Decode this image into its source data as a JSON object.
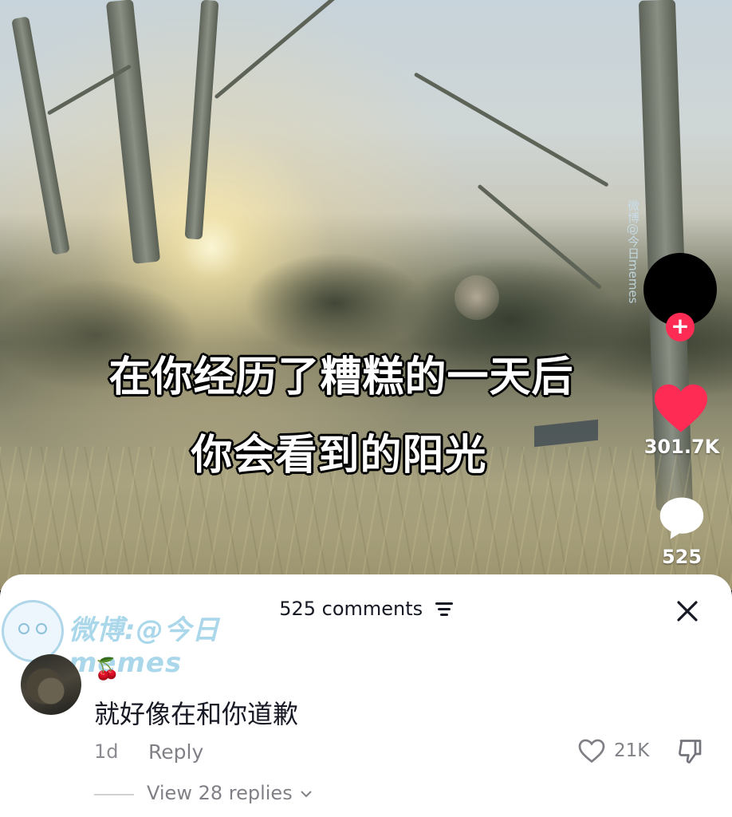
{
  "video": {
    "caption_line1": "在你经历了糟糕的一天后",
    "caption_line2": "你会看到的阳光",
    "watermark_vertical": "微博@今日memes"
  },
  "actions": {
    "follow_symbol": "+",
    "like_count": "301.7K",
    "comment_count": "525"
  },
  "comments": {
    "header": "525 comments",
    "watermark": "微博:@今日memes",
    "items": [
      {
        "username_emoji": "🍒",
        "text": "就好像在和你道歉",
        "time": "1d",
        "reply_label": "Reply",
        "like_count": "21K",
        "view_replies": "View 28 replies"
      }
    ]
  },
  "colors": {
    "accent": "#fe2c55",
    "sheet_bg": "#ffffff",
    "text_primary": "#161823"
  }
}
